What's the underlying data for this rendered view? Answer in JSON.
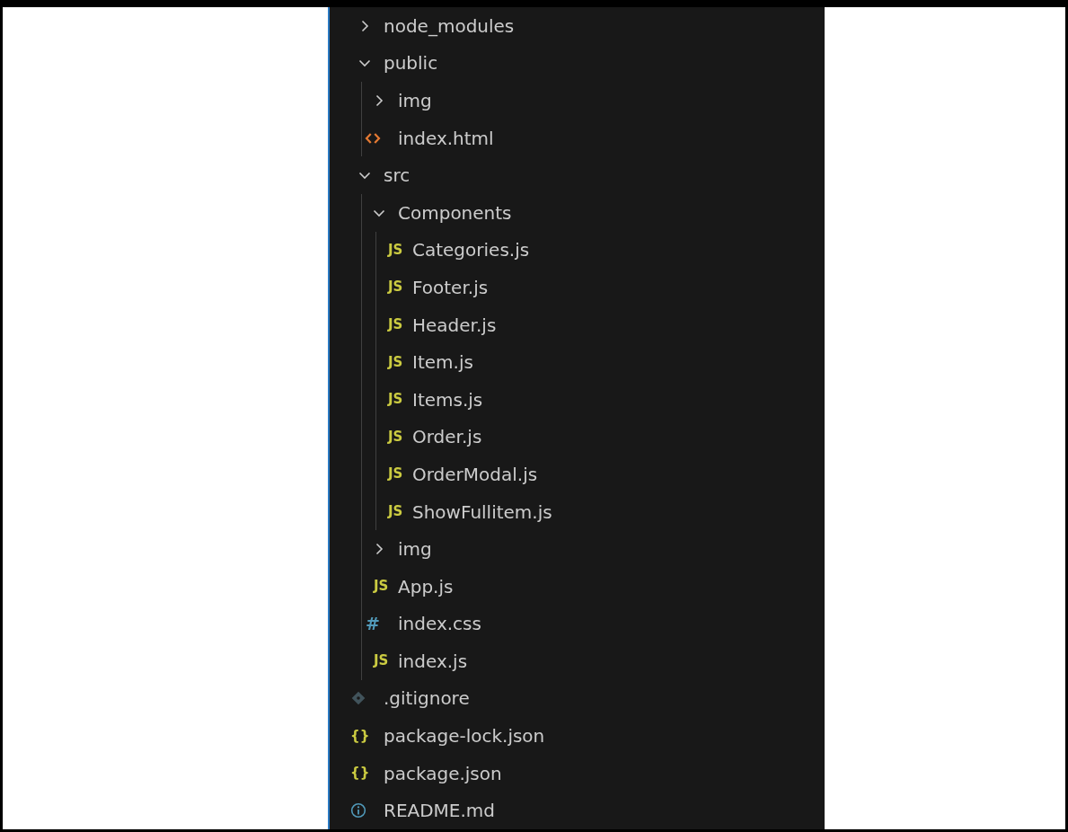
{
  "tree": [
    {
      "kind": "folder",
      "name": "node_modules",
      "expanded": false
    },
    {
      "kind": "folder",
      "name": "public",
      "expanded": true,
      "children": [
        {
          "kind": "folder",
          "name": "img",
          "expanded": false
        },
        {
          "kind": "html",
          "name": "index.html"
        }
      ]
    },
    {
      "kind": "folder",
      "name": "src",
      "expanded": true,
      "children": [
        {
          "kind": "folder",
          "name": "Components",
          "expanded": true,
          "children": [
            {
              "kind": "js",
              "badge": "JS",
              "name": "Categories.js"
            },
            {
              "kind": "js",
              "badge": "JS",
              "name": "Footer.js"
            },
            {
              "kind": "js",
              "badge": "JS",
              "name": "Header.js"
            },
            {
              "kind": "js",
              "badge": "JS",
              "name": "Item.js"
            },
            {
              "kind": "js",
              "badge": "JS",
              "name": "Items.js"
            },
            {
              "kind": "js",
              "badge": "JS",
              "name": "Order.js"
            },
            {
              "kind": "js",
              "badge": "JS",
              "name": "OrderModal.js"
            },
            {
              "kind": "js",
              "badge": "JS",
              "name": "ShowFullitem.js"
            }
          ]
        },
        {
          "kind": "folder",
          "name": "img",
          "expanded": false
        },
        {
          "kind": "js",
          "badge": "JS",
          "name": "App.js"
        },
        {
          "kind": "css",
          "badge": "#",
          "name": "index.css"
        },
        {
          "kind": "js",
          "badge": "JS",
          "name": "index.js"
        }
      ]
    },
    {
      "kind": "git",
      "name": ".gitignore"
    },
    {
      "kind": "json",
      "badge": "{}",
      "name": "package-lock.json"
    },
    {
      "kind": "json",
      "badge": "{}",
      "name": "package.json"
    },
    {
      "kind": "info",
      "name": "README.md"
    }
  ]
}
